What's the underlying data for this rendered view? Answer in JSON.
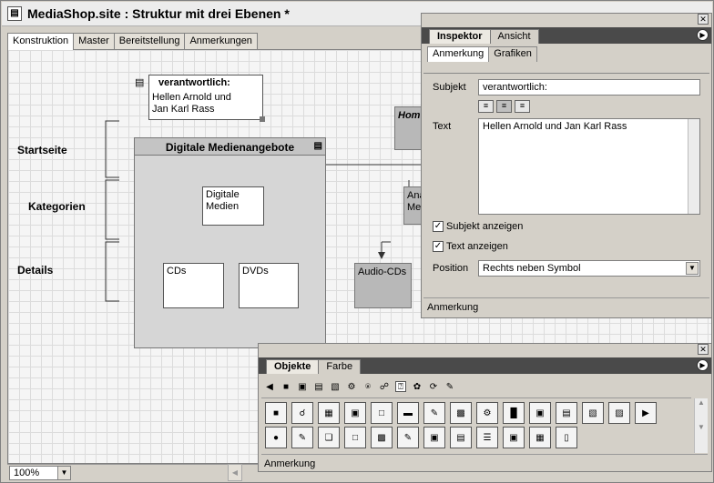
{
  "window": {
    "title": "MediaShop.site : Struktur mit drei Ebenen *"
  },
  "doc_tabs": [
    "Konstruktion",
    "Master",
    "Bereitstellung",
    "Anmerkungen"
  ],
  "canvas": {
    "note": {
      "title": "verantwortlich:",
      "text_line1": "Hellen Arnold und",
      "text_line2": "Jan Karl Rass"
    },
    "labels": {
      "startseite": "Startseite",
      "kategorien": "Kategorien",
      "details": "Details"
    },
    "group_title": "Digitale Medienangebote",
    "nodes": {
      "digitale": "Digitale\nMedien",
      "cds": "CDs",
      "dvds": "DVDs",
      "audio": "Audio-CDs",
      "home": "Hom",
      "ana": "Ana\nMe"
    }
  },
  "status": {
    "zoom": "100%"
  },
  "inspector": {
    "tabs": [
      "Inspektor",
      "Ansicht"
    ],
    "subtabs": [
      "Anmerkung",
      "Grafiken"
    ],
    "subjekt_label": "Subjekt",
    "subjekt_value": "verantwortlich:",
    "text_label": "Text",
    "text_value": "Hellen Arnold und Jan Karl Rass",
    "chk_subjekt": "Subjekt anzeigen",
    "chk_text": "Text anzeigen",
    "position_label": "Position",
    "position_value": "Rechts neben Symbol",
    "footer": "Anmerkung"
  },
  "objects": {
    "tabs": [
      "Objekte",
      "Farbe"
    ],
    "footer": "Anmerkung"
  }
}
